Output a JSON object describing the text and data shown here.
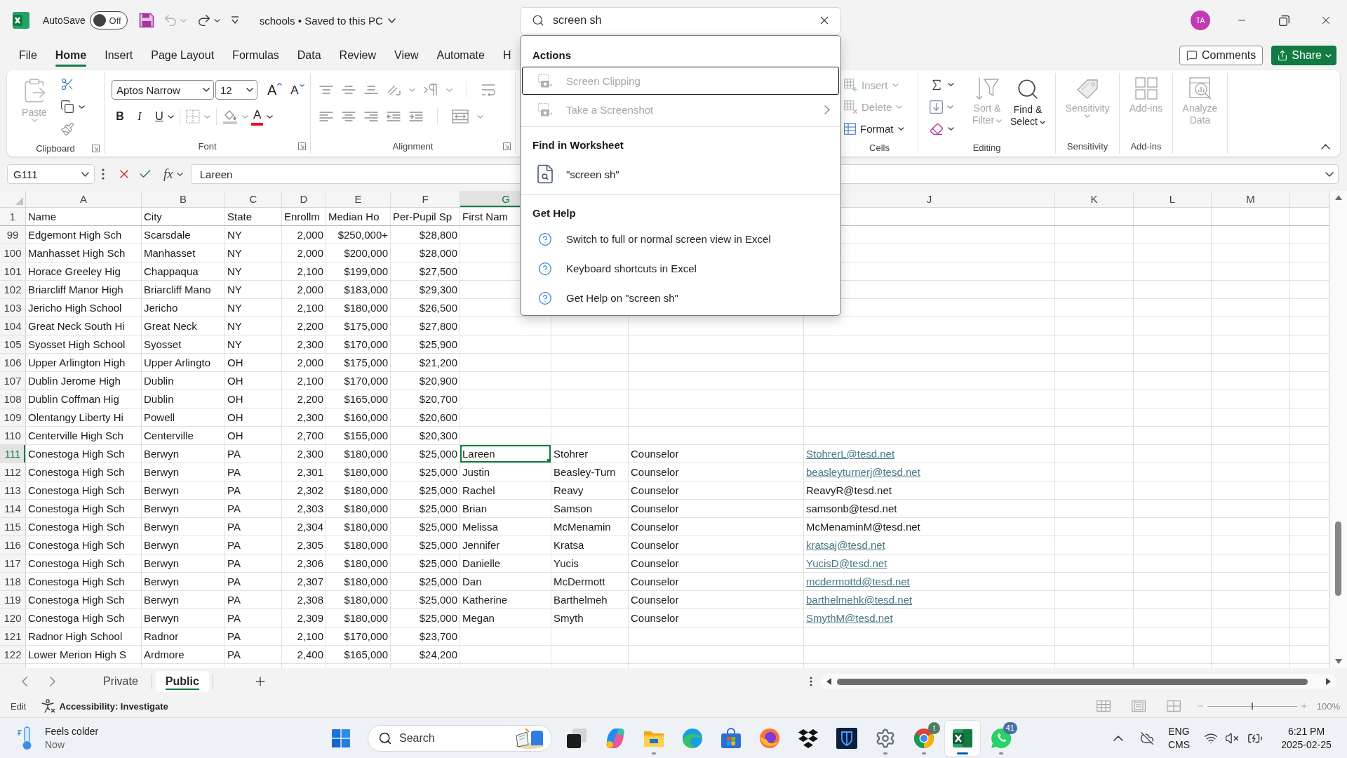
{
  "title_bar": {
    "autosave": {
      "label": "AutoSave",
      "state_label": "Off",
      "on": false
    },
    "quick_access": [
      {
        "kind": "save",
        "disabled": false
      },
      {
        "kind": "undo",
        "disabled": true
      },
      {
        "kind": "redo",
        "disabled": false
      },
      {
        "kind": "customize",
        "disabled": false
      }
    ],
    "document_title": "schools • Saved to this PC",
    "account_initials": "TA"
  },
  "search": {
    "value": "screen sh",
    "sections": [
      {
        "heading": "Actions",
        "items": [
          {
            "kind": "action",
            "label": "Screen Clipping",
            "disabled": true,
            "focused": true,
            "submenu": false
          },
          {
            "kind": "action",
            "label": "Take a Screenshot",
            "disabled": true,
            "focused": false,
            "submenu": true
          }
        ]
      },
      {
        "heading": "Find in Worksheet",
        "items": [
          {
            "kind": "find",
            "label": "\"screen sh\"",
            "disabled": false,
            "focused": false,
            "submenu": false
          }
        ]
      },
      {
        "heading": "Get Help",
        "items": [
          {
            "kind": "help",
            "label": "Switch to full or normal screen view in Excel",
            "disabled": false,
            "focused": false,
            "submenu": false
          },
          {
            "kind": "help",
            "label": "Keyboard shortcuts in Excel",
            "disabled": false,
            "focused": false,
            "submenu": false
          },
          {
            "kind": "help",
            "label": "Get Help on \"screen sh\"",
            "disabled": false,
            "focused": false,
            "submenu": false
          }
        ]
      }
    ]
  },
  "menu_tabs": [
    {
      "label": "File",
      "selected": false
    },
    {
      "label": "Home",
      "selected": true
    },
    {
      "label": "Insert",
      "selected": false
    },
    {
      "label": "Page Layout",
      "selected": false
    },
    {
      "label": "Formulas",
      "selected": false
    },
    {
      "label": "Data",
      "selected": false
    },
    {
      "label": "Review",
      "selected": false
    },
    {
      "label": "View",
      "selected": false
    },
    {
      "label": "Automate",
      "selected": false
    },
    {
      "label": "H",
      "selected": false
    }
  ],
  "header_actions": {
    "comments": "Comments",
    "share": "Share"
  },
  "ribbon": {
    "clipboard": {
      "paste": {
        "label": "Paste",
        "disabled": true
      },
      "label": "Clipboard"
    },
    "font": {
      "font_name": "Aptos Narrow",
      "font_size": "12",
      "grow_font": "A",
      "shrink_font": "A",
      "bold": "B",
      "italic": "I",
      "underline": "U",
      "font_color": "A",
      "label": "Font"
    },
    "alignment": {
      "label": "Alignment"
    },
    "cells": {
      "buttons": [
        {
          "kind": "insert",
          "label": "Insert",
          "disabled": true
        },
        {
          "kind": "delete",
          "label": "Delete",
          "disabled": true
        },
        {
          "kind": "format",
          "label": "Format",
          "disabled": false
        }
      ],
      "label": "Cells"
    },
    "editing": {
      "buttons": [
        {
          "kind": "sort",
          "label": "Sort & Filter",
          "disabled": true
        },
        {
          "kind": "find",
          "label": "Find & Select",
          "disabled": false
        }
      ],
      "label": "Editing"
    },
    "sensitivity": {
      "button": {
        "label": "Sensitivity",
        "disabled": true
      },
      "label": "Sensitivity"
    },
    "add_ins": {
      "button": {
        "label": "Add-ins",
        "disabled": true
      },
      "label": "Add-ins"
    },
    "analysis": {
      "button": {
        "label": "Analyze Data",
        "disabled": true
      }
    }
  },
  "formula_bar": {
    "name_box": "G111",
    "function_label": "fx",
    "value": "Lareen"
  },
  "sheet": {
    "columns": [
      {
        "label": "A",
        "selected": false
      },
      {
        "label": "B",
        "selected": false
      },
      {
        "label": "C",
        "selected": false
      },
      {
        "label": "D",
        "selected": false
      },
      {
        "label": "E",
        "selected": false
      },
      {
        "label": "F",
        "selected": false
      },
      {
        "label": "G",
        "selected": true
      },
      {
        "label": "J",
        "selected": false
      },
      {
        "label": "K",
        "selected": false
      },
      {
        "label": "L",
        "selected": false
      },
      {
        "label": "M",
        "selected": false
      }
    ],
    "rows": [
      {
        "kind": "header",
        "number": "1",
        "selected": false,
        "cells": [
          "Name",
          "City",
          "State",
          "Enrollm",
          "Median Ho",
          "Per-Pupil Sp",
          "First Nam"
        ]
      },
      {
        "kind": "data",
        "number": "99",
        "selected": false,
        "cells": [
          "Edgemont High Sch",
          "Scarsdale",
          "NY",
          "2,000",
          "$250,000+",
          "$28,800"
        ]
      },
      {
        "kind": "data",
        "number": "100",
        "selected": false,
        "cells": [
          "Manhasset High Sch",
          "Manhasset",
          "NY",
          "2,000",
          "$200,000",
          "$28,000"
        ]
      },
      {
        "kind": "data",
        "number": "101",
        "selected": false,
        "cells": [
          "Horace Greeley Hig",
          "Chappaqua",
          "NY",
          "2,100",
          "$199,000",
          "$27,500"
        ]
      },
      {
        "kind": "data",
        "number": "102",
        "selected": false,
        "cells": [
          "Briarcliff Manor High",
          "Briarcliff Mano",
          "NY",
          "2,000",
          "$183,000",
          "$29,300"
        ]
      },
      {
        "kind": "data",
        "number": "103",
        "selected": false,
        "cells": [
          "Jericho High School",
          "Jericho",
          "NY",
          "2,100",
          "$180,000",
          "$26,500"
        ]
      },
      {
        "kind": "data",
        "number": "104",
        "selected": false,
        "cells": [
          "Great Neck South Hi",
          "Great Neck",
          "NY",
          "2,200",
          "$175,000",
          "$27,800"
        ]
      },
      {
        "kind": "data",
        "number": "105",
        "selected": false,
        "cells": [
          "Syosset High School",
          "Syosset",
          "NY",
          "2,300",
          "$170,000",
          "$25,900"
        ]
      },
      {
        "kind": "data",
        "number": "106",
        "selected": false,
        "cells": [
          "Upper Arlington High",
          "Upper Arlingto",
          "OH",
          "2,000",
          "$175,000",
          "$21,200"
        ]
      },
      {
        "kind": "data",
        "number": "107",
        "selected": false,
        "cells": [
          "Dublin Jerome High",
          "Dublin",
          "OH",
          "2,100",
          "$170,000",
          "$20,900"
        ]
      },
      {
        "kind": "data",
        "number": "108",
        "selected": false,
        "cells": [
          "Dublin Coffman Hig",
          "Dublin",
          "OH",
          "2,200",
          "$165,000",
          "$20,700"
        ]
      },
      {
        "kind": "data",
        "number": "109",
        "selected": false,
        "cells": [
          "Olentangy Liberty Hi",
          "Powell",
          "OH",
          "2,300",
          "$160,000",
          "$20,600"
        ]
      },
      {
        "kind": "data",
        "number": "110",
        "selected": false,
        "cells": [
          "Centerville High Sch",
          "Centerville",
          "OH",
          "2,700",
          "$155,000",
          "$20,300"
        ]
      },
      {
        "kind": "data",
        "number": "111",
        "selected": true,
        "cells": [
          "Conestoga High Sch",
          "Berwyn",
          "PA",
          "2,300",
          "$180,000",
          "$25,000",
          "Lareen",
          "Stohrer",
          "Counselor"
        ],
        "email": {
          "text": "StohrerL@tesd.net",
          "hyperlink": true
        }
      },
      {
        "kind": "data",
        "number": "112",
        "selected": false,
        "cells": [
          "Conestoga High Sch",
          "Berwyn",
          "PA",
          "2,301",
          "$180,000",
          "$25,000",
          "Justin",
          "Beasley-Turn",
          "Counselor"
        ],
        "email": {
          "text": "beasleyturnerj@tesd.net",
          "hyperlink": true
        }
      },
      {
        "kind": "data",
        "number": "113",
        "selected": false,
        "cells": [
          "Conestoga High Sch",
          "Berwyn",
          "PA",
          "2,302",
          "$180,000",
          "$25,000",
          "Rachel",
          "Reavy",
          "Counselor"
        ],
        "email": {
          "text": "ReavyR@tesd.net",
          "hyperlink": false
        }
      },
      {
        "kind": "data",
        "number": "114",
        "selected": false,
        "cells": [
          "Conestoga High Sch",
          "Berwyn",
          "PA",
          "2,303",
          "$180,000",
          "$25,000",
          "Brian",
          "Samson",
          "Counselor"
        ],
        "email": {
          "text": "samsonb@tesd.net",
          "hyperlink": false
        }
      },
      {
        "kind": "data",
        "number": "115",
        "selected": false,
        "cells": [
          "Conestoga High Sch",
          "Berwyn",
          "PA",
          "2,304",
          "$180,000",
          "$25,000",
          "Melissa",
          "McMenamin",
          "Counselor"
        ],
        "email": {
          "text": "McMenaminM@tesd.net",
          "hyperlink": false
        }
      },
      {
        "kind": "data",
        "number": "116",
        "selected": false,
        "cells": [
          "Conestoga High Sch",
          "Berwyn",
          "PA",
          "2,305",
          "$180,000",
          "$25,000",
          "Jennifer",
          "Kratsa",
          "Counselor"
        ],
        "email": {
          "text": "kratsaj@tesd.net",
          "hyperlink": true
        }
      },
      {
        "kind": "data",
        "number": "117",
        "selected": false,
        "cells": [
          "Conestoga High Sch",
          "Berwyn",
          "PA",
          "2,306",
          "$180,000",
          "$25,000",
          "Danielle",
          "Yucis",
          "Counselor"
        ],
        "email": {
          "text": "YucisD@tesd.net",
          "hyperlink": true
        }
      },
      {
        "kind": "data",
        "number": "118",
        "selected": false,
        "cells": [
          "Conestoga High Sch",
          "Berwyn",
          "PA",
          "2,307",
          "$180,000",
          "$25,000",
          "Dan",
          "McDermott",
          "Counselor"
        ],
        "email": {
          "text": "mcdermottd@tesd.net",
          "hyperlink": true
        }
      },
      {
        "kind": "data",
        "number": "119",
        "selected": false,
        "cells": [
          "Conestoga High Sch",
          "Berwyn",
          "PA",
          "2,308",
          "$180,000",
          "$25,000",
          "Katherine",
          "Barthelmeh",
          "Counselor"
        ],
        "email": {
          "text": "barthelmehk@tesd.net",
          "hyperlink": true
        }
      },
      {
        "kind": "data",
        "number": "120",
        "selected": false,
        "cells": [
          "Conestoga High Sch",
          "Berwyn",
          "PA",
          "2,309",
          "$180,000",
          "$25,000",
          "Megan",
          "Smyth",
          "Counselor"
        ],
        "email": {
          "text": "SmythM@tesd.net",
          "hyperlink": true
        }
      },
      {
        "kind": "data",
        "number": "121",
        "selected": false,
        "cells": [
          "Radnor High School",
          "Radnor",
          "PA",
          "2,100",
          "$170,000",
          "$23,700"
        ]
      },
      {
        "kind": "data",
        "number": "122",
        "selected": false,
        "cells": [
          "Lower Merion High S",
          "Ardmore",
          "PA",
          "2,400",
          "$165,000",
          "$24,200"
        ]
      }
    ]
  },
  "sheet_tabs": [
    {
      "label": "Private",
      "selected": false
    },
    {
      "label": "Public",
      "selected": true
    }
  ],
  "status_bar": {
    "mode": "Edit",
    "accessibility": "Accessibility: Investigate",
    "zoom": {
      "level": 0.5,
      "reading": "100%"
    }
  },
  "taskbar": {
    "weather": {
      "title": "Feels colder",
      "subtitle": "Now"
    },
    "search_placeholder": "Search",
    "apps": [
      {
        "kind": "task-view",
        "running": false,
        "active": false
      },
      {
        "kind": "copilot",
        "running": false,
        "active": false
      },
      {
        "kind": "files",
        "running": true,
        "active": false
      },
      {
        "kind": "edge",
        "running": false,
        "active": false
      },
      {
        "kind": "store",
        "running": false,
        "active": false
      },
      {
        "kind": "firefox",
        "running": false,
        "active": false
      },
      {
        "kind": "dropbox",
        "running": false,
        "active": false
      },
      {
        "kind": "vault",
        "running": false,
        "active": false
      },
      {
        "kind": "settings",
        "running": true,
        "active": false
      },
      {
        "kind": "chrome",
        "running": true,
        "active": false,
        "badge": "t"
      },
      {
        "kind": "excel",
        "running": true,
        "active": true
      },
      {
        "kind": "whatsapp",
        "running": true,
        "active": false,
        "badge": "41"
      }
    ],
    "tray": {
      "language": "ENG",
      "input_method": "CMS",
      "time": "6:21 PM",
      "date": "2025-02-25"
    }
  }
}
